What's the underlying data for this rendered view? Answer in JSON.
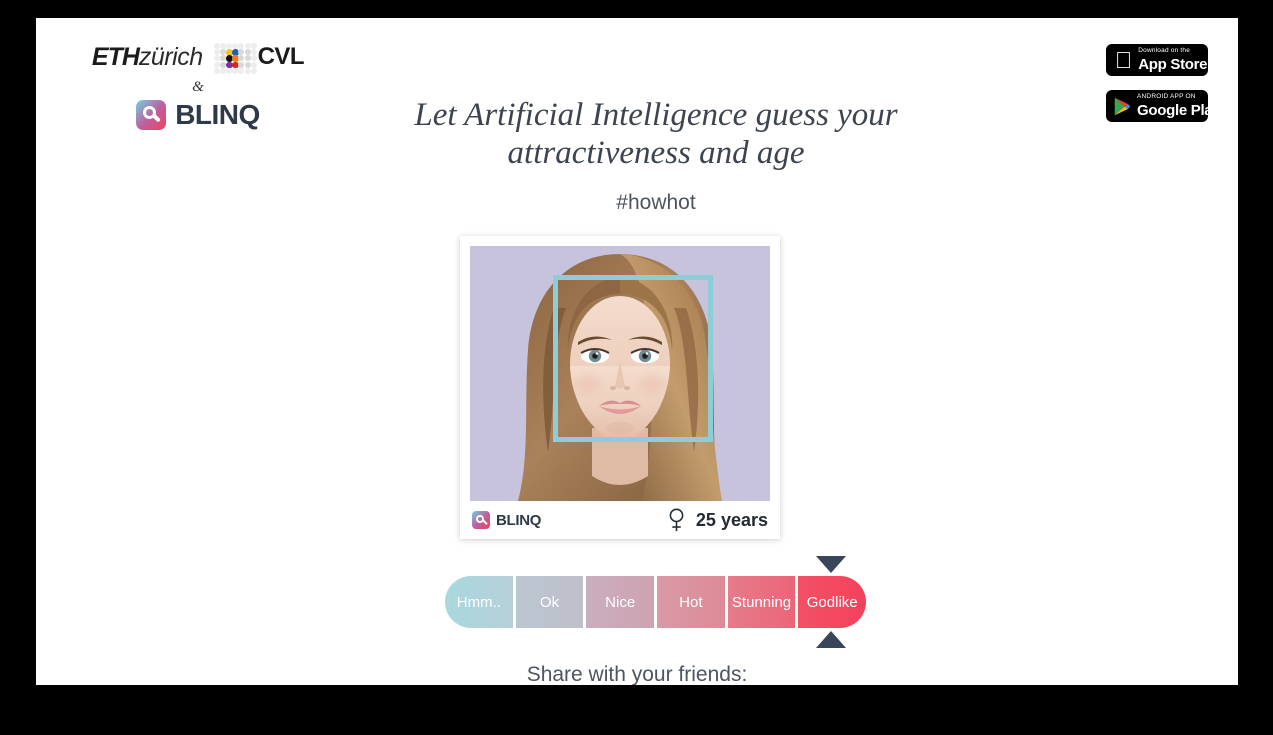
{
  "branding": {
    "eth_bold": "ETH",
    "eth_light": "zürich",
    "cvl": "CVL",
    "ampersand": "&",
    "blinq": "BLINQ",
    "cvl_dot_colors": [
      "#f5c518",
      "#1f5fc0",
      "#111111",
      "#ef7d1a",
      "#7b2fa0",
      "#e02424"
    ],
    "gradient_start": "#6fd4e0",
    "gradient_end": "#f2415a"
  },
  "header": {
    "title_line_1": "Let Artificial Intelligence guess your",
    "title_line_2": "attractiveness and age",
    "hashtag": "#howhot"
  },
  "badges": [
    {
      "icon": "apple-icon",
      "small": "Download on the",
      "big": "App Store"
    },
    {
      "icon": "google-play-icon",
      "small": "ANDROID APP ON",
      "big": "Google Play"
    }
  ],
  "card": {
    "watermark": "BLINQ",
    "gender_icon": "female-venus-icon",
    "age": "25 years",
    "face_box_color": "#8ecdd8",
    "photo_background": "#c7c3dd"
  },
  "rating_scale": {
    "marker_color": "#39465a",
    "selected": "Godlike",
    "segments": [
      {
        "label": "Hmm..",
        "color_from": "#a9d8de",
        "color_to": "#b6d0d9"
      },
      {
        "label": "Ok",
        "color_from": "#bbc6d1",
        "color_to": "#c0bfcb"
      },
      {
        "label": "Nice",
        "color_from": "#c9afbd",
        "color_to": "#cfa2b2"
      },
      {
        "label": "Hot",
        "color_from": "#d89aa6",
        "color_to": "#dd8a97"
      },
      {
        "label": "Stunning",
        "color_from": "#e57c8a",
        "color_to": "#ed6477"
      },
      {
        "label": "Godlike",
        "color_from": "#f35165",
        "color_to": "#f4415c"
      }
    ]
  },
  "footer": {
    "share_label": "Share with your friends:"
  }
}
